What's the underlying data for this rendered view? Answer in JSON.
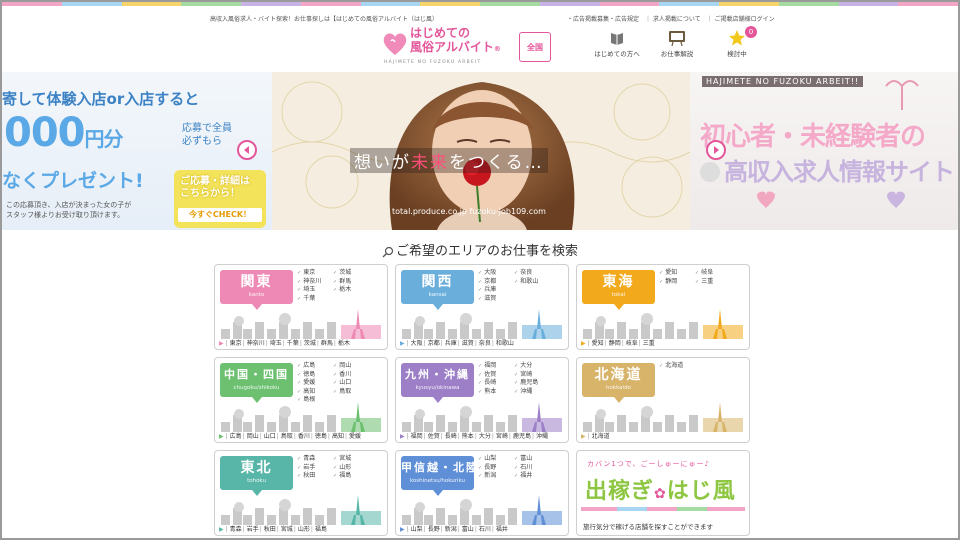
{
  "colors": {
    "brand_pink": "#e3569a",
    "kanto": "#ee88b4",
    "kansai": "#6aaedc",
    "tokai": "#f2a91c",
    "chugoku": "#6cc070",
    "kyushu": "#9c7fc6",
    "hokkaido": "#d7b46a",
    "tohoku": "#58b6a8",
    "koshinetsu": "#5f8fd6"
  },
  "header": {
    "tagline": "高収入風俗求人・バイト探索！お仕事探しは【はじめての風俗アルバイト（はじ風）",
    "logo": {
      "line1": "はじめての",
      "line2": "風俗アルバイト",
      "reg": "®",
      "sub": "HAJIMETE NO FUZOKU ARBEIT"
    },
    "region_button": "全国",
    "links": [
      "・広告掲載募集・広告規定",
      "｜ 求人掲載について",
      "｜ ご掲載店舗様ログイン"
    ],
    "icons": [
      {
        "label": "はじめての方へ",
        "icon": "book-icon"
      },
      {
        "label": "お仕事解説",
        "icon": "board-icon"
      },
      {
        "label": "検討中",
        "icon": "star-icon",
        "badge": "0"
      }
    ]
  },
  "banner": {
    "left": {
      "top_text": "寄して体験入店or入店すると",
      "amount": "000",
      "amount_unit": "円分",
      "present": "なくプレゼント!",
      "bubble": [
        "応募で全員",
        "必ずもら"
      ],
      "box_lines": [
        "ご応募・詳細は",
        "こちらから！"
      ],
      "check": "今すぐCHECK！",
      "note": [
        "この応募頂き、入店が決まった女の子が",
        "スタッフ様よりお受け取り頂けます。"
      ]
    },
    "center": {
      "caption_pre": "想いが",
      "caption_hl": "未来",
      "caption_post": "をつくる…",
      "url": "total.produce.co.jp   fuzoku-job109.com"
    },
    "right": {
      "top": "HAJIMETE NO FUZOKU ARBEIT!!",
      "line1": "初心者・未経験者の",
      "line2": "高収入求人情報サイト"
    }
  },
  "search": {
    "title": "ご希望のエリアのお仕事を検索",
    "regions": [
      {
        "name": "関東",
        "romaji": "kanto",
        "color_key": "kanto",
        "prefs": [
          "東京",
          "茨城",
          "神奈川",
          "群馬",
          "埼玉",
          "栃木",
          "千葉"
        ],
        "links": [
          "東京",
          "神奈川",
          "埼玉",
          "千葉",
          "茨城",
          "群馬",
          "栃木"
        ]
      },
      {
        "name": "関西",
        "romaji": "kansai",
        "color_key": "kansai",
        "prefs": [
          "大阪",
          "奈良",
          "京都",
          "和歌山",
          "兵庫",
          "",
          "滋賀"
        ],
        "links": [
          "大阪",
          "京都",
          "兵庫",
          "滋賀",
          "奈良",
          "和歌山"
        ]
      },
      {
        "name": "東海",
        "romaji": "tokai",
        "color_key": "tokai",
        "prefs": [
          "愛知",
          "岐阜",
          "静岡",
          "三重"
        ],
        "links": [
          "愛知",
          "静岡",
          "岐阜",
          "三重"
        ]
      },
      {
        "name": "中国・四国",
        "romaji": "chugoku/shikoku",
        "color_key": "chugoku",
        "prefs": [
          "広島",
          "岡山",
          "徳島",
          "香川",
          "愛媛",
          "山口",
          "高知",
          "鳥取",
          "島根"
        ],
        "links": [
          "広島",
          "岡山",
          "山口",
          "鳥取",
          "香川",
          "徳島",
          "高知",
          "愛媛"
        ]
      },
      {
        "name": "九州・沖縄",
        "romaji": "kyusyu/okinawa",
        "color_key": "kyushu",
        "prefs": [
          "福岡",
          "大分",
          "佐賀",
          "宮崎",
          "長崎",
          "鹿児島",
          "熊本",
          "沖縄"
        ],
        "links": [
          "福岡",
          "佐賀",
          "長崎",
          "熊本",
          "大分",
          "宮崎",
          "鹿児島",
          "沖縄"
        ]
      },
      {
        "name": "北海道",
        "romaji": "hokkaido",
        "color_key": "hokkaido",
        "prefs": [
          "北海道"
        ],
        "links": [
          "北海道"
        ]
      },
      {
        "name": "東北",
        "romaji": "tohoku",
        "color_key": "tohoku",
        "prefs": [
          "青森",
          "宮城",
          "岩手",
          "山形",
          "秋田",
          "福島"
        ],
        "links": [
          "青森",
          "岩手",
          "秋田",
          "宮城",
          "山形",
          "福島"
        ]
      },
      {
        "name": "甲信越・北陸",
        "romaji": "koshinetsu/hokuriku",
        "color_key": "koshinetsu",
        "prefs": [
          "山梨",
          "富山",
          "長野",
          "石川",
          "新潟",
          "福井"
        ],
        "links": [
          "山梨",
          "長野",
          "新潟",
          "富山",
          "石川",
          "福井"
        ]
      }
    ],
    "dekasegi": {
      "top": "カバン1つで、ごーしゅーにゅー♪",
      "main": "出稼ぎ",
      "main2": "はじ風",
      "note": "旅行気分で稼げる店舗を探すことができます"
    }
  }
}
